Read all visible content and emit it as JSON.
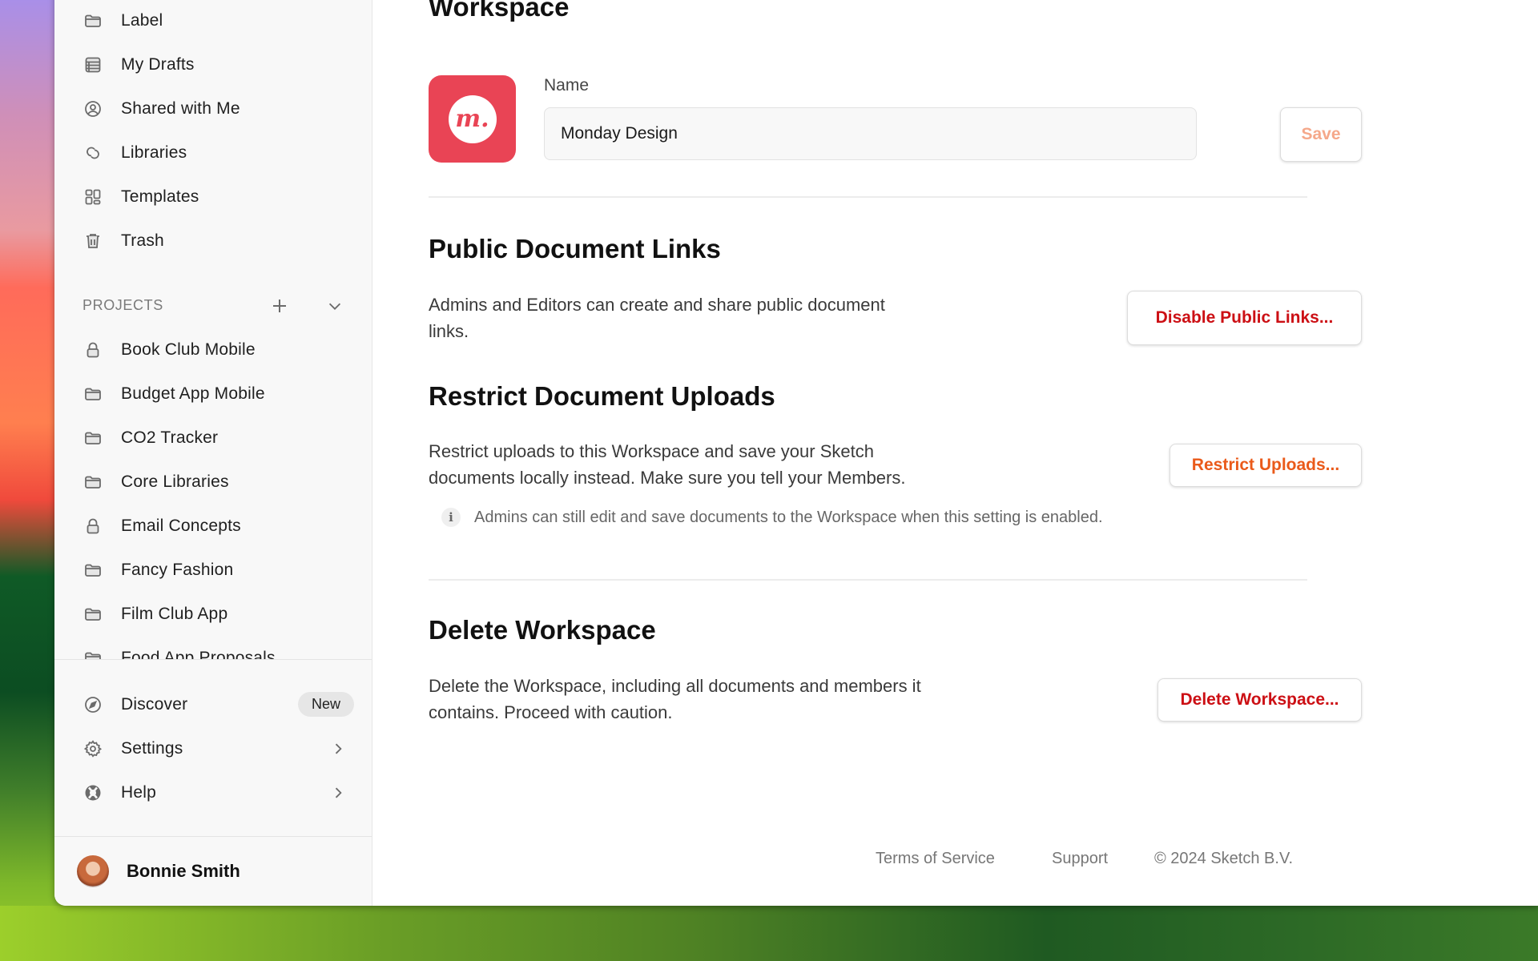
{
  "sidebar": {
    "nav_items": [
      {
        "label": "Label",
        "icon": "folder-icon"
      },
      {
        "label": "My Drafts",
        "icon": "drafts-icon"
      },
      {
        "label": "Shared with Me",
        "icon": "user-circle-icon"
      },
      {
        "label": "Libraries",
        "icon": "libraries-link-icon"
      },
      {
        "label": "Templates",
        "icon": "templates-grid-icon"
      },
      {
        "label": "Trash",
        "icon": "trash-icon"
      }
    ],
    "projects_header": "PROJECTS",
    "projects": [
      {
        "label": "Book Club Mobile",
        "icon": "lock-icon"
      },
      {
        "label": "Budget App Mobile",
        "icon": "folder-icon"
      },
      {
        "label": "CO2 Tracker",
        "icon": "folder-icon"
      },
      {
        "label": "Core Libraries",
        "icon": "folder-icon"
      },
      {
        "label": "Email Concepts",
        "icon": "lock-icon"
      },
      {
        "label": "Fancy Fashion",
        "icon": "folder-icon"
      },
      {
        "label": "Film Club App",
        "icon": "folder-icon"
      },
      {
        "label": "Food App Proposals",
        "icon": "folder-icon"
      }
    ],
    "bottom_items": [
      {
        "label": "Discover",
        "icon": "compass-icon",
        "badge": "New"
      },
      {
        "label": "Settings",
        "icon": "gear-icon"
      },
      {
        "label": "Help",
        "icon": "lifebuoy-icon"
      }
    ],
    "user": {
      "name": "Bonnie Smith"
    }
  },
  "main": {
    "title": "Workspace",
    "logo_letter": "m.",
    "name_label": "Name",
    "name_value": "Monday Design",
    "save_label": "Save",
    "public_links": {
      "heading": "Public Document Links",
      "line1": "Admins and Editors can create and share public document",
      "line2": "links.",
      "button": "Disable Public Links..."
    },
    "restrict_uploads": {
      "heading": "Restrict Document Uploads",
      "line1": "Restrict uploads to this Workspace and save your Sketch",
      "line2": "documents locally instead. Make sure you tell your Members.",
      "button": "Restrict Uploads...",
      "info": "Admins can still edit and save documents to the Workspace when this setting is enabled."
    },
    "delete_workspace": {
      "heading": "Delete Workspace",
      "line1": "Delete the Workspace, including all documents and members it",
      "line2": "contains. Proceed with caution.",
      "button": "Delete Workspace..."
    }
  },
  "footer": {
    "terms": "Terms of Service",
    "support": "Support",
    "copyright": "© 2024 Sketch B.V."
  },
  "colors": {
    "brand": "#e94455",
    "danger": "#cc0f14",
    "warning": "#ea5a1a",
    "save_disabled": "#f5a88a"
  }
}
